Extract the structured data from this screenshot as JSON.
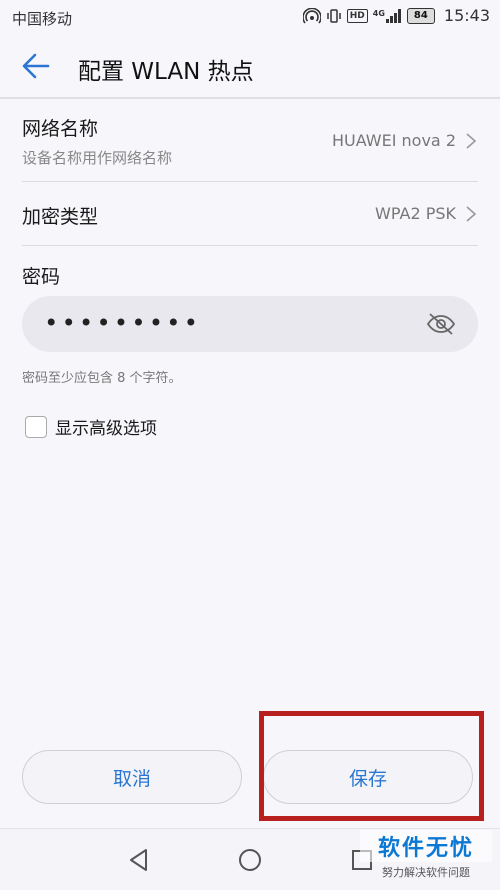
{
  "status_bar": {
    "carrier": "中国移动",
    "network_tag": "HD",
    "signal_label": "4G",
    "battery": "84",
    "time": "15:43"
  },
  "app_bar": {
    "title": "配置 WLAN 热点"
  },
  "settings": {
    "network_name": {
      "title": "网络名称",
      "subtitle": "设备名称用作网络名称",
      "value": "HUAWEI nova 2"
    },
    "encryption": {
      "title": "加密类型",
      "value": "WPA2 PSK"
    },
    "password": {
      "label": "密码",
      "value": "•••••••••",
      "hint": "密码至少应包含 8 个字符。"
    },
    "advanced": {
      "label": "显示高级选项",
      "checked": false
    }
  },
  "actions": {
    "cancel": "取消",
    "save": "保存"
  },
  "colors": {
    "accent": "#2a76d2",
    "highlight": "#b8201f"
  },
  "icons": {
    "back": "arrow-left-icon",
    "chevron": "chevron-right-icon",
    "eye": "eye-off-icon",
    "nav_back": "triangle-back-icon",
    "nav_home": "circle-home-icon",
    "nav_recent": "square-recent-icon"
  },
  "watermark": {
    "main": "软件无忧",
    "sub": "努力解决软件问题"
  }
}
